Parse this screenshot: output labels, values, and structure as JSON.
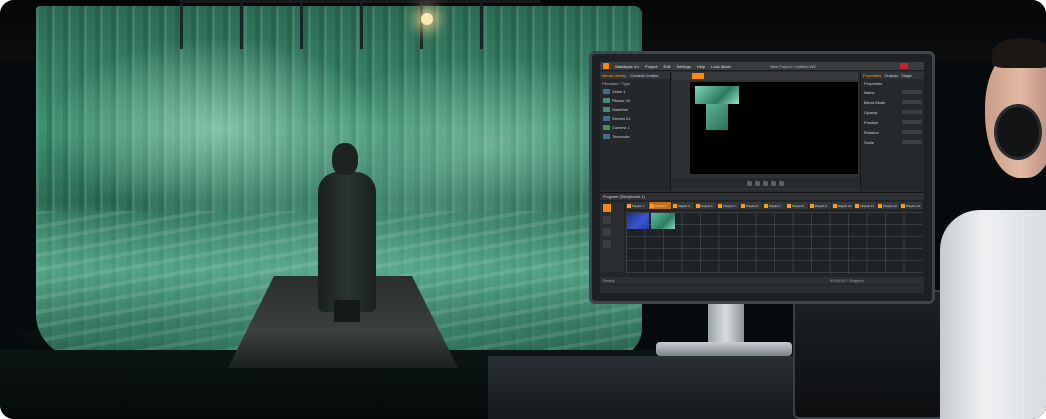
{
  "software": {
    "app_name": "Watchpax 4.x",
    "menu": [
      "Project",
      "Edit",
      "Settings",
      "Help",
      "Lock Mode"
    ],
    "window_title": "New Project / Untitled.WX",
    "left_panel": {
      "tabs": [
        "Media Library",
        "Content Creator"
      ],
      "header": "Filename / Type",
      "files": [
        {
          "name": "Video 1",
          "thumb": "blue"
        },
        {
          "name": "Picture 4K",
          "thumb": "green"
        },
        {
          "name": "Waterfall",
          "thumb": "green"
        },
        {
          "name": "Stream 01",
          "thumb": "blue"
        },
        {
          "name": "Camera 1",
          "thumb": "green"
        },
        {
          "name": "Timecode",
          "thumb": "blue"
        }
      ]
    },
    "properties": {
      "tabs": [
        "Properties",
        "Outputs",
        "Stage"
      ],
      "title": "Properties",
      "rows": [
        "Name",
        "Blend Mode",
        "Opacity",
        "Position",
        "Rotation",
        "Scale"
      ]
    },
    "timeline": {
      "title": "Program (Storyboard 1)",
      "cues": [
        "Playlist 1",
        "Playlist 2",
        "Playlist 3",
        "Playlist 4",
        "Playlist 5",
        "Playlist 6",
        "Playlist 7",
        "Playlist 8",
        "Playlist 9",
        "Playlist 10",
        "Playlist 11",
        "Playlist 12",
        "Playlist 13"
      ],
      "active_cue_index": 1
    },
    "status_left": "Ready",
    "status_right": "00:00:00 / Stopped"
  },
  "colors": {
    "accent": "#ff8a00",
    "projection": "#3f8f71",
    "close": "#c0262b"
  }
}
